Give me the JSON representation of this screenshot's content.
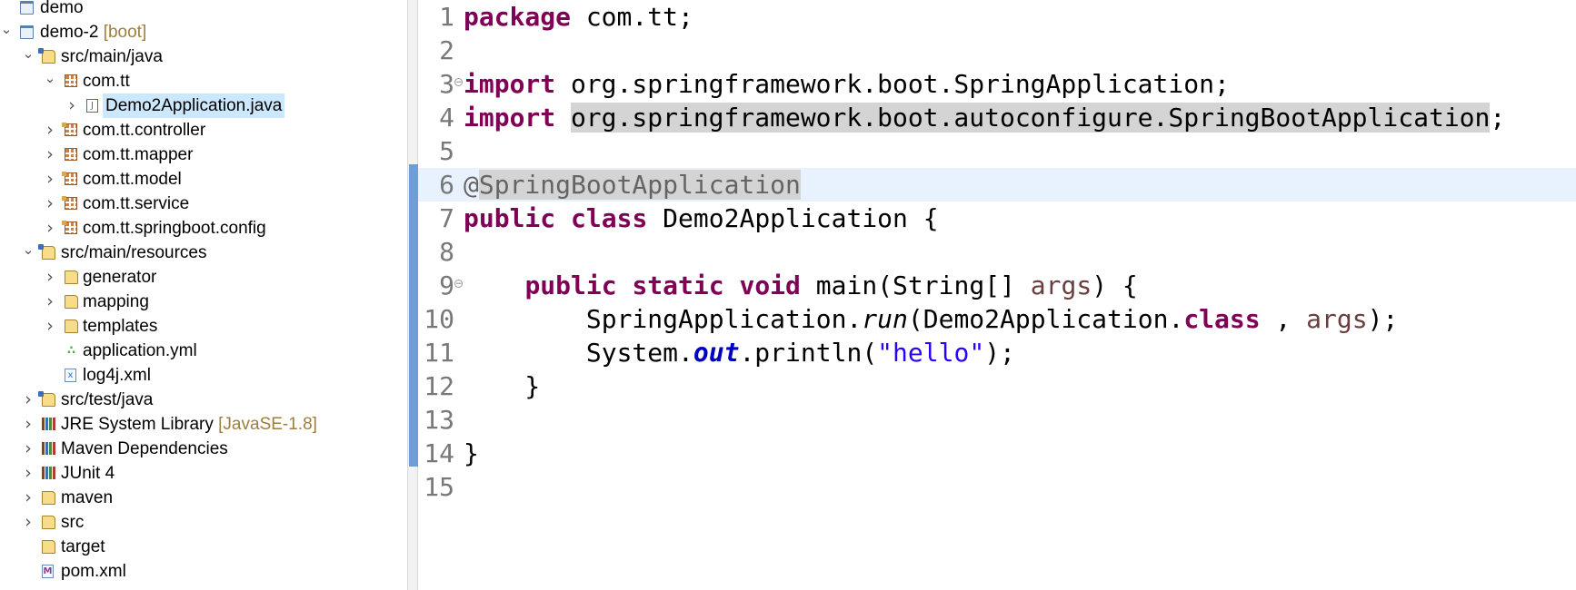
{
  "explorer": {
    "rows": [
      {
        "label": "demo",
        "decor": ""
      },
      {
        "label": "demo-2",
        "decor": "[boot]"
      },
      {
        "label": "src/main/java",
        "decor": ""
      },
      {
        "label": "com.tt",
        "decor": ""
      },
      {
        "label": "Demo2Application.java",
        "decor": ""
      },
      {
        "label": "com.tt.controller",
        "decor": ""
      },
      {
        "label": "com.tt.mapper",
        "decor": ""
      },
      {
        "label": "com.tt.model",
        "decor": ""
      },
      {
        "label": "com.tt.service",
        "decor": ""
      },
      {
        "label": "com.tt.springboot.config",
        "decor": ""
      },
      {
        "label": "src/main/resources",
        "decor": ""
      },
      {
        "label": "generator",
        "decor": ""
      },
      {
        "label": "mapping",
        "decor": ""
      },
      {
        "label": "templates",
        "decor": ""
      },
      {
        "label": "application.yml",
        "decor": ""
      },
      {
        "label": "log4j.xml",
        "decor": ""
      },
      {
        "label": "src/test/java",
        "decor": ""
      },
      {
        "label": "JRE System Library",
        "decor": "[JavaSE-1.8]"
      },
      {
        "label": "Maven Dependencies",
        "decor": ""
      },
      {
        "label": "JUnit 4",
        "decor": ""
      },
      {
        "label": "maven",
        "decor": ""
      },
      {
        "label": "src",
        "decor": ""
      },
      {
        "label": "target",
        "decor": ""
      },
      {
        "label": "pom.xml",
        "decor": ""
      }
    ],
    "icons": [
      "project-icon",
      "project-icon",
      "source-folder-icon",
      "package-icon",
      "java-file-icon",
      "package-icon",
      "package-icon",
      "package-icon",
      "package-icon",
      "package-icon",
      "source-folder-icon",
      "folder-icon",
      "folder-icon",
      "folder-icon",
      "yaml-file-icon",
      "xml-file-icon",
      "source-folder-icon",
      "library-icon",
      "library-icon",
      "library-icon",
      "folder-icon",
      "folder-icon",
      "folder-icon",
      "pom-file-icon"
    ]
  },
  "editor": {
    "current_line": 6,
    "lines": [
      {
        "num": "1",
        "tokens": [
          [
            "kw",
            "package"
          ],
          [
            "",
            "com.tt;"
          ]
        ]
      },
      {
        "num": "2",
        "tokens": []
      },
      {
        "num": "3",
        "tokens": [
          [
            "kw",
            "import"
          ],
          [
            "",
            "org.springframework.boot.SpringApplication;"
          ]
        ]
      },
      {
        "num": "4",
        "tokens": [
          [
            "kw",
            "import"
          ],
          [
            "occ",
            "org.springframework.boot.autoconfigure.SpringBootApplication"
          ],
          [
            "",
            ";"
          ]
        ]
      },
      {
        "num": "5",
        "tokens": []
      },
      {
        "num": "6",
        "tokens": [
          [
            "ann",
            "@"
          ],
          [
            "ann occ",
            "SpringBootApplication"
          ]
        ]
      },
      {
        "num": "7",
        "tokens": [
          [
            "kw",
            "public"
          ],
          [
            "",
            " "
          ],
          [
            "kw",
            "class"
          ],
          [
            "",
            " Demo2Application {"
          ]
        ]
      },
      {
        "num": "8",
        "tokens": []
      },
      {
        "num": "9",
        "tokens": [
          [
            "",
            "    "
          ],
          [
            "kw",
            "public"
          ],
          [
            "",
            " "
          ],
          [
            "kw",
            "static"
          ],
          [
            "",
            " "
          ],
          [
            "kw",
            "void"
          ],
          [
            "",
            " main(String[] "
          ],
          [
            "param",
            "args"
          ],
          [
            "",
            ") {"
          ]
        ]
      },
      {
        "num": "10",
        "tokens": [
          [
            "",
            "        SpringApplication."
          ],
          [
            "static-call",
            "run"
          ],
          [
            "",
            "(Demo2Application."
          ],
          [
            "kw",
            "class"
          ],
          [
            "",
            ", "
          ],
          [
            "param",
            "args"
          ],
          [
            "",
            ");"
          ]
        ]
      },
      {
        "num": "11",
        "tokens": [
          [
            "",
            "        System."
          ],
          [
            "field",
            "out"
          ],
          [
            "",
            ".println("
          ],
          [
            "str",
            "\"hello\""
          ],
          [
            "",
            ");"
          ]
        ]
      },
      {
        "num": "12",
        "tokens": [
          [
            "",
            "    }"
          ]
        ]
      },
      {
        "num": "13",
        "tokens": []
      },
      {
        "num": "14",
        "tokens": [
          [
            "",
            "}"
          ]
        ]
      },
      {
        "num": "15",
        "tokens": []
      }
    ]
  },
  "colors": {
    "keyword": "#7f0055",
    "annotation": "#646464",
    "string": "#2a00ff",
    "field": "#0000c0",
    "parameter": "#6a3e3e",
    "line_number": "#787878",
    "current_line": "#e8f2fe",
    "selection": "#cce8ff"
  }
}
